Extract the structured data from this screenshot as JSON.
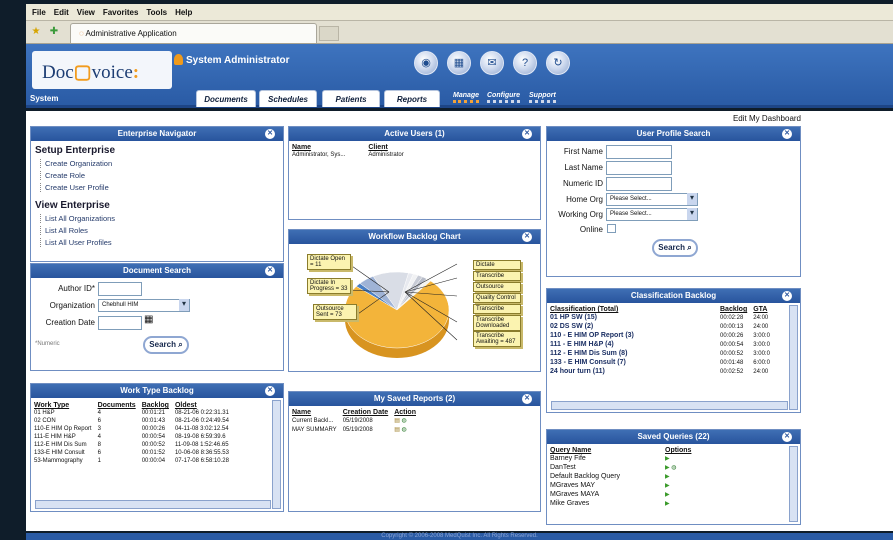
{
  "menu": [
    "File",
    "Edit",
    "View",
    "Favorites",
    "Tools",
    "Help"
  ],
  "tab_title": "Administrative Application",
  "header": {
    "logo": "Doc Voice",
    "role": "System Administrator",
    "system_label": "System",
    "tabs": [
      "Documents",
      "Schedules",
      "Patients",
      "Reports"
    ],
    "links": [
      "Manage",
      "Configure",
      "Support"
    ],
    "icons": [
      "globe-icon",
      "calculator-icon",
      "mail-icon",
      "help-icon",
      "refresh-icon"
    ]
  },
  "edit_dashboard": "Edit My Dashboard",
  "enterprise": {
    "title": "Enterprise Navigator",
    "setup": "Setup Enterprise",
    "setup_links": [
      "Create Organization",
      "Create Role",
      "Create User Profile"
    ],
    "view": "View Enterprise",
    "view_links": [
      "List All Organizations",
      "List All Roles",
      "List All User Profiles"
    ]
  },
  "doc_search": {
    "title": "Document Search",
    "author_label": "Author ID*",
    "org_label": "Organization",
    "org_value": "Chebhull HIM",
    "date_label": "Creation Date",
    "note": "*Numeric",
    "search": "Search"
  },
  "work_type": {
    "title": "Work Type Backlog",
    "headers": [
      "Work Type",
      "Documents",
      "Backlog",
      "Oldest"
    ],
    "rows": [
      [
        "01 H&P",
        "4",
        "00:01:21",
        "08-21-06 0:22:31.31"
      ],
      [
        "02 CON",
        "6",
        "00:01:43",
        "08-21-06 0:24:49.54"
      ],
      [
        "110-E HIM Op Report",
        "3",
        "00:00:26",
        "04-11-08 3:02:12.54"
      ],
      [
        "111-E HIM H&P",
        "4",
        "00:00:54",
        "08-19-08 6:59:39.6"
      ],
      [
        "112-E HIM Dis Sum",
        "8",
        "00:00:52",
        "11-09-08 1:52:46.65"
      ],
      [
        "133-E HIM Consult",
        "6",
        "00:01:52",
        "10-06-08 8:36:55.53"
      ],
      [
        "53-Mammography",
        "1",
        "00:00:04",
        "07-17-08 6:58:10.28"
      ]
    ]
  },
  "active_users": {
    "title": "Active Users (1)",
    "headers": [
      "Name",
      "Client"
    ],
    "rows": [
      [
        "Administrator, Sys...",
        "Administrator"
      ]
    ]
  },
  "workflow": {
    "title": "Workflow Backlog Chart"
  },
  "chart_data": {
    "type": "pie",
    "labels": [
      "Dictate Open",
      "Dictate In Progress",
      "Outsource Sent",
      "Dictate",
      "Transcribe",
      "Outsource",
      "Quality Control",
      "Transcribe Downloaded",
      "Transcribe Awaiting"
    ],
    "annotations": [
      "Dictate Open = 11",
      "Dictate In Progress = 33",
      "Outsource Sent = 73",
      "Transcribe Awaiting = 487"
    ],
    "values": [
      11,
      33,
      73,
      null,
      null,
      null,
      null,
      null,
      487
    ],
    "colors": [
      "#4a7fc4",
      "#9fb3d6",
      "#d9dde6",
      "#e7e9ef",
      "#f1f2f4",
      "#c8ccd6",
      "#b7bcc8",
      "#f5f5f0",
      "#f3b43a"
    ]
  },
  "saved_reports": {
    "title": "My Saved Reports (2)",
    "headers": [
      "Name",
      "Creation Date",
      "Action"
    ],
    "rows": [
      [
        "Current Backl...",
        "05/19/2008"
      ],
      [
        "MAY SUMMARY",
        "05/19/2008"
      ]
    ]
  },
  "profile_search": {
    "title": "User Profile Search",
    "labels": [
      "First Name",
      "Last Name",
      "Numeric ID",
      "Home Org",
      "Working Org",
      "Online"
    ],
    "select_placeholder": "Please Select...",
    "search": "Search"
  },
  "classification": {
    "title": "Classification Backlog",
    "headers": [
      "Classification (Total)",
      "Backlog",
      "GTA"
    ],
    "rows": [
      [
        "01 HP SW (15)",
        "00:02:28",
        "24:00"
      ],
      [
        "02 DS SW (2)",
        "00:00:13",
        "24:00"
      ],
      [
        "110 - E HIM OP Report (3)",
        "00:00:26",
        "3:00:0"
      ],
      [
        "111 - E HIM H&P (4)",
        "00:00:54",
        "3:00:0"
      ],
      [
        "112 - E HIM Dis Sum (8)",
        "00:00:52",
        "3:00:0"
      ],
      [
        "133 - E HIM Consult (7)",
        "00:01:48",
        "6:00:0"
      ],
      [
        "24 hour turn (11)",
        "00:02:52",
        "24:00"
      ]
    ]
  },
  "queries": {
    "title": "Saved Queries (22)",
    "headers": [
      "Query Name",
      "Options"
    ],
    "rows": [
      "Barney Fife",
      "DanTest",
      "Default Backlog Query",
      "MGraves MAY",
      "MGraves MAYA",
      "Mike Graves"
    ]
  },
  "footer": "Copyright © 2006-2008 MedQuist Inc. All Rights Reserved."
}
